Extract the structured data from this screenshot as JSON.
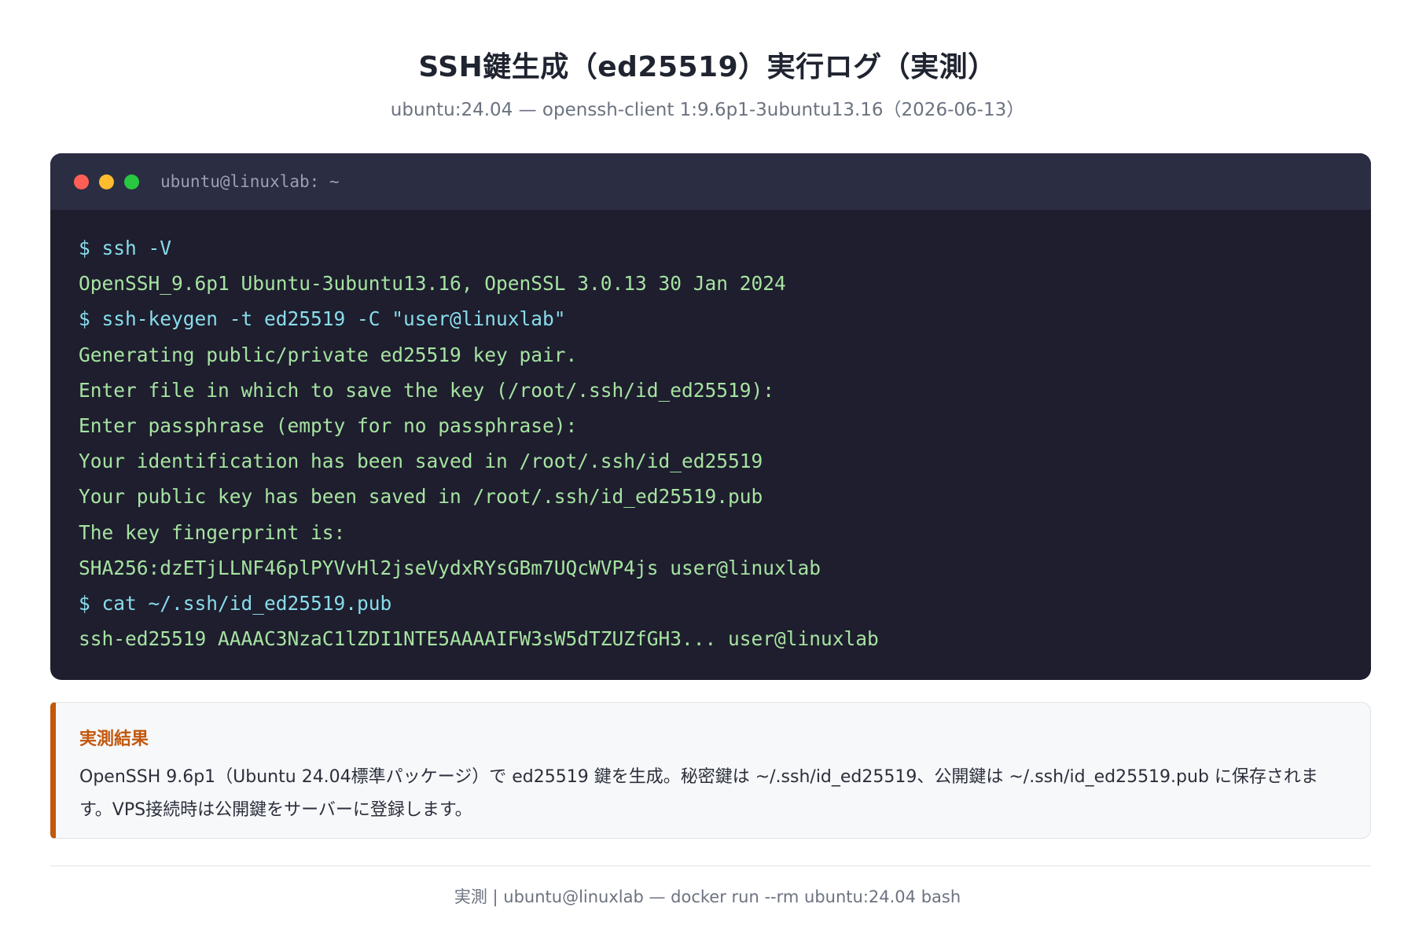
{
  "header": {
    "title": "SSH鍵生成（ed25519）実行ログ（実測）",
    "subtitle": "ubuntu:24.04 — openssh-client 1:9.6p1-3ubuntu13.16（2026-06-13）"
  },
  "terminal": {
    "window_title": "ubuntu@linuxlab: ~",
    "lines": [
      {
        "kind": "cmd",
        "text": "$ ssh -V"
      },
      {
        "kind": "out",
        "text": "OpenSSH_9.6p1 Ubuntu-3ubuntu13.16, OpenSSL 3.0.13 30 Jan 2024"
      },
      {
        "kind": "cmd",
        "text": "$ ssh-keygen -t ed25519 -C \"user@linuxlab\""
      },
      {
        "kind": "out",
        "text": "Generating public/private ed25519 key pair."
      },
      {
        "kind": "out",
        "text": "Enter file in which to save the key (/root/.ssh/id_ed25519):"
      },
      {
        "kind": "out",
        "text": "Enter passphrase (empty for no passphrase):"
      },
      {
        "kind": "out",
        "text": "Your identification has been saved in /root/.ssh/id_ed25519"
      },
      {
        "kind": "out",
        "text": "Your public key has been saved in /root/.ssh/id_ed25519.pub"
      },
      {
        "kind": "out",
        "text": "The key fingerprint is:"
      },
      {
        "kind": "out",
        "text": "SHA256:dzETjLLNF46plPYVvHl2jseVydxRYsGBm7UQcWVP4js user@linuxlab"
      },
      {
        "kind": "cmd",
        "text": "$ cat ~/.ssh/id_ed25519.pub"
      },
      {
        "kind": "out",
        "text": "ssh-ed25519 AAAAC3NzaC1lZDI1NTE5AAAAIFW3sW5dTZUZfGH3... user@linuxlab"
      }
    ]
  },
  "result": {
    "heading": "実測結果",
    "text": "OpenSSH 9.6p1（Ubuntu 24.04標準パッケージ）で ed25519 鍵を生成。秘密鍵は ~/.ssh/id_ed25519、公開鍵は ~/.ssh/id_ed25519.pub に保存されます。VPS接続時は公開鍵をサーバーに登録します。"
  },
  "footer": {
    "text": "実測 | ubuntu@linuxlab — docker run --rm ubuntu:24.04 bash"
  },
  "colors": {
    "terminal_bg": "#1e1e2e",
    "terminal_header": "#2b2d42",
    "command": "#89dceb",
    "output": "#a6e3a1",
    "accent": "#c2570c",
    "dot_close": "#ff5f57",
    "dot_minimize": "#febc2e",
    "dot_maximize": "#28c840"
  }
}
